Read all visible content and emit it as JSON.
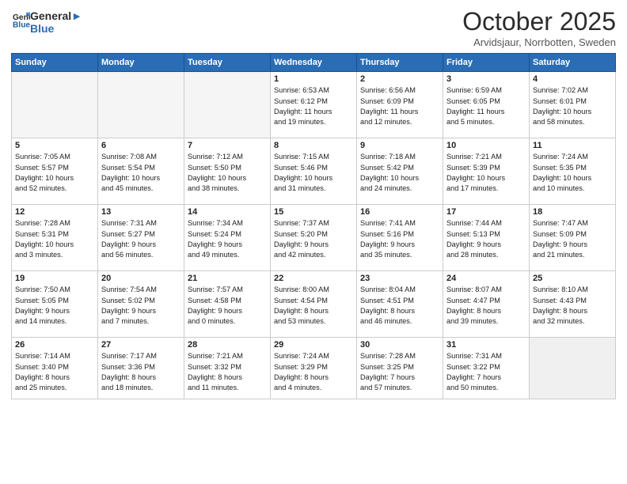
{
  "header": {
    "logo_line1": "General",
    "logo_line2": "Blue",
    "month": "October 2025",
    "location": "Arvidsjaur, Norrbotten, Sweden"
  },
  "days_of_week": [
    "Sunday",
    "Monday",
    "Tuesday",
    "Wednesday",
    "Thursday",
    "Friday",
    "Saturday"
  ],
  "weeks": [
    [
      {
        "day": "",
        "text": "",
        "empty": true
      },
      {
        "day": "",
        "text": "",
        "empty": true
      },
      {
        "day": "",
        "text": "",
        "empty": true
      },
      {
        "day": "1",
        "text": "Sunrise: 6:53 AM\nSunset: 6:12 PM\nDaylight: 11 hours\nand 19 minutes."
      },
      {
        "day": "2",
        "text": "Sunrise: 6:56 AM\nSunset: 6:09 PM\nDaylight: 11 hours\nand 12 minutes."
      },
      {
        "day": "3",
        "text": "Sunrise: 6:59 AM\nSunset: 6:05 PM\nDaylight: 11 hours\nand 5 minutes."
      },
      {
        "day": "4",
        "text": "Sunrise: 7:02 AM\nSunset: 6:01 PM\nDaylight: 10 hours\nand 58 minutes."
      }
    ],
    [
      {
        "day": "5",
        "text": "Sunrise: 7:05 AM\nSunset: 5:57 PM\nDaylight: 10 hours\nand 52 minutes."
      },
      {
        "day": "6",
        "text": "Sunrise: 7:08 AM\nSunset: 5:54 PM\nDaylight: 10 hours\nand 45 minutes."
      },
      {
        "day": "7",
        "text": "Sunrise: 7:12 AM\nSunset: 5:50 PM\nDaylight: 10 hours\nand 38 minutes."
      },
      {
        "day": "8",
        "text": "Sunrise: 7:15 AM\nSunset: 5:46 PM\nDaylight: 10 hours\nand 31 minutes."
      },
      {
        "day": "9",
        "text": "Sunrise: 7:18 AM\nSunset: 5:42 PM\nDaylight: 10 hours\nand 24 minutes."
      },
      {
        "day": "10",
        "text": "Sunrise: 7:21 AM\nSunset: 5:39 PM\nDaylight: 10 hours\nand 17 minutes."
      },
      {
        "day": "11",
        "text": "Sunrise: 7:24 AM\nSunset: 5:35 PM\nDaylight: 10 hours\nand 10 minutes."
      }
    ],
    [
      {
        "day": "12",
        "text": "Sunrise: 7:28 AM\nSunset: 5:31 PM\nDaylight: 10 hours\nand 3 minutes."
      },
      {
        "day": "13",
        "text": "Sunrise: 7:31 AM\nSunset: 5:27 PM\nDaylight: 9 hours\nand 56 minutes."
      },
      {
        "day": "14",
        "text": "Sunrise: 7:34 AM\nSunset: 5:24 PM\nDaylight: 9 hours\nand 49 minutes."
      },
      {
        "day": "15",
        "text": "Sunrise: 7:37 AM\nSunset: 5:20 PM\nDaylight: 9 hours\nand 42 minutes."
      },
      {
        "day": "16",
        "text": "Sunrise: 7:41 AM\nSunset: 5:16 PM\nDaylight: 9 hours\nand 35 minutes."
      },
      {
        "day": "17",
        "text": "Sunrise: 7:44 AM\nSunset: 5:13 PM\nDaylight: 9 hours\nand 28 minutes."
      },
      {
        "day": "18",
        "text": "Sunrise: 7:47 AM\nSunset: 5:09 PM\nDaylight: 9 hours\nand 21 minutes."
      }
    ],
    [
      {
        "day": "19",
        "text": "Sunrise: 7:50 AM\nSunset: 5:05 PM\nDaylight: 9 hours\nand 14 minutes."
      },
      {
        "day": "20",
        "text": "Sunrise: 7:54 AM\nSunset: 5:02 PM\nDaylight: 9 hours\nand 7 minutes."
      },
      {
        "day": "21",
        "text": "Sunrise: 7:57 AM\nSunset: 4:58 PM\nDaylight: 9 hours\nand 0 minutes."
      },
      {
        "day": "22",
        "text": "Sunrise: 8:00 AM\nSunset: 4:54 PM\nDaylight: 8 hours\nand 53 minutes."
      },
      {
        "day": "23",
        "text": "Sunrise: 8:04 AM\nSunset: 4:51 PM\nDaylight: 8 hours\nand 46 minutes."
      },
      {
        "day": "24",
        "text": "Sunrise: 8:07 AM\nSunset: 4:47 PM\nDaylight: 8 hours\nand 39 minutes."
      },
      {
        "day": "25",
        "text": "Sunrise: 8:10 AM\nSunset: 4:43 PM\nDaylight: 8 hours\nand 32 minutes."
      }
    ],
    [
      {
        "day": "26",
        "text": "Sunrise: 7:14 AM\nSunset: 3:40 PM\nDaylight: 8 hours\nand 25 minutes."
      },
      {
        "day": "27",
        "text": "Sunrise: 7:17 AM\nSunset: 3:36 PM\nDaylight: 8 hours\nand 18 minutes."
      },
      {
        "day": "28",
        "text": "Sunrise: 7:21 AM\nSunset: 3:32 PM\nDaylight: 8 hours\nand 11 minutes."
      },
      {
        "day": "29",
        "text": "Sunrise: 7:24 AM\nSunset: 3:29 PM\nDaylight: 8 hours\nand 4 minutes."
      },
      {
        "day": "30",
        "text": "Sunrise: 7:28 AM\nSunset: 3:25 PM\nDaylight: 7 hours\nand 57 minutes."
      },
      {
        "day": "31",
        "text": "Sunrise: 7:31 AM\nSunset: 3:22 PM\nDaylight: 7 hours\nand 50 minutes."
      },
      {
        "day": "",
        "text": "",
        "empty": true,
        "shaded": true
      }
    ]
  ]
}
